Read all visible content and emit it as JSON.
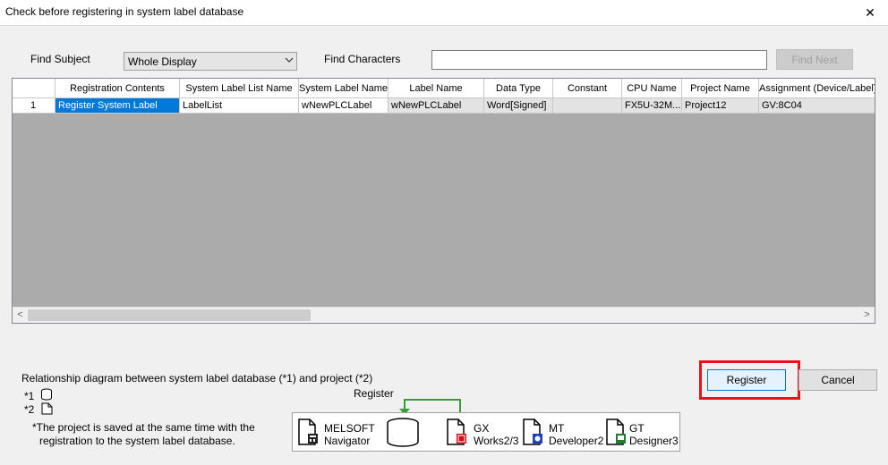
{
  "window": {
    "title": "Check before registering in system label database"
  },
  "find": {
    "subject_label": "Find Subject",
    "subject_value": "Whole Display",
    "characters_label": "Find Characters",
    "characters_value": "",
    "find_next": "Find Next"
  },
  "grid": {
    "columns": [
      "",
      "Registration Contents",
      "System Label List Name",
      "System Label Name",
      "Label Name",
      "Data Type",
      "Constant",
      "CPU Name",
      "Project Name",
      "Assignment (Device/Label)"
    ],
    "rows": [
      [
        "1",
        "Register System Label",
        "LabelList",
        "wNewPLCLabel",
        "wNewPLCLabel",
        "Word[Signed]",
        "",
        "FX5U-32M...",
        "Project12",
        "GV:8C04"
      ]
    ]
  },
  "legend": {
    "heading": "Relationship diagram between system label database (*1) and project (*2)",
    "mark1": "*1",
    "mark2": "*2",
    "note_line1": "*The project is saved at the same time with the",
    "note_line2": "registration to the system label database."
  },
  "diagram": {
    "register_label": "Register",
    "melsoft_line1": "MELSOFT",
    "melsoft_line2": "Navigator",
    "gx_line1": "GX",
    "gx_line2": "Works2/3",
    "mt_line1": "MT",
    "mt_line2": "Developer2",
    "gt_line1": "GT",
    "gt_line2": "Designer3"
  },
  "buttons": {
    "register": "Register",
    "cancel": "Cancel"
  },
  "colors": {
    "selection": "#0078d7",
    "highlight_frame": "#e8111d",
    "arrow": "#3a9b3a"
  }
}
